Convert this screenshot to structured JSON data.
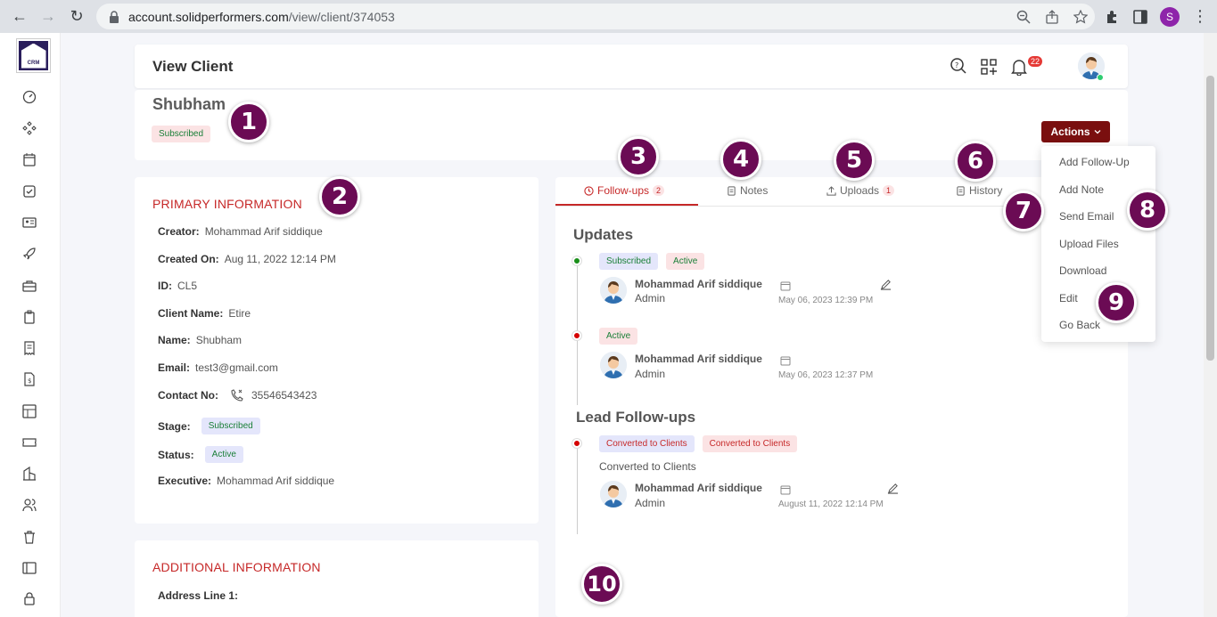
{
  "browser": {
    "url_host": "account.solidperformers.com",
    "url_path": "/view/client/374053",
    "profile_initial": "S"
  },
  "brand": {
    "logo_text": "CRM"
  },
  "header": {
    "title": "View Client",
    "notification_count": "22"
  },
  "client": {
    "name": "Shubham",
    "stage_badge": "Subscribed"
  },
  "actions": {
    "button_label": "Actions",
    "menu": [
      "Add Follow-Up",
      "Add Note",
      "Send Email",
      "Upload Files",
      "Download",
      "Edit",
      "Go Back"
    ]
  },
  "primary": {
    "title": "PRIMARY INFORMATION",
    "rows": [
      {
        "label": "Creator:",
        "value": "Mohammad Arif siddique"
      },
      {
        "label": "Created On:",
        "value": "Aug 11, 2022 12:14 PM"
      },
      {
        "label": "ID:",
        "value": "CL5"
      },
      {
        "label": "Client Name:",
        "value": "Etire"
      },
      {
        "label": "Name:",
        "value": "Shubham"
      },
      {
        "label": "Email:",
        "value": "test3@gmail.com"
      },
      {
        "label": "Contact No:",
        "value": "35546543423"
      },
      {
        "label": "Stage:",
        "value": "Subscribed"
      },
      {
        "label": "Status:",
        "value": "Active"
      },
      {
        "label": "Executive:",
        "value": "Mohammad Arif siddique"
      }
    ]
  },
  "additional": {
    "title": "ADDITIONAL INFORMATION",
    "row_label": "Address Line 1:"
  },
  "tabs": [
    {
      "label": "Follow-ups",
      "count": "2",
      "icon": "clock-icon"
    },
    {
      "label": "Notes",
      "count": "",
      "icon": "note-icon"
    },
    {
      "label": "Uploads",
      "count": "1",
      "icon": "upload-icon"
    },
    {
      "label": "History",
      "count": "",
      "icon": "history-icon"
    }
  ],
  "updates": {
    "title": "Updates",
    "items": [
      {
        "pills": [
          "Subscribed",
          "Active"
        ],
        "author": "Mohammad Arif siddique",
        "role": "Admin",
        "date": "May 06, 2023 12:39 PM"
      },
      {
        "pills": [
          "Active"
        ],
        "author": "Mohammad Arif siddique",
        "role": "Admin",
        "date": "May 06, 2023 12:37 PM"
      }
    ]
  },
  "lead_followups": {
    "title": "Lead Follow-ups",
    "items": [
      {
        "pills": [
          "Converted to Clients",
          "Converted to Clients"
        ],
        "note": "Converted to Clients",
        "author": "Mohammad Arif siddique",
        "role": "Admin",
        "date": "August 11, 2022 12:14 PM"
      }
    ]
  },
  "annotations": [
    "1",
    "2",
    "3",
    "4",
    "5",
    "6",
    "7",
    "8",
    "9",
    "10"
  ],
  "colors": {
    "accent": "#c62828",
    "action_button": "#7a0f0f",
    "annotation": "#6b0b54"
  }
}
